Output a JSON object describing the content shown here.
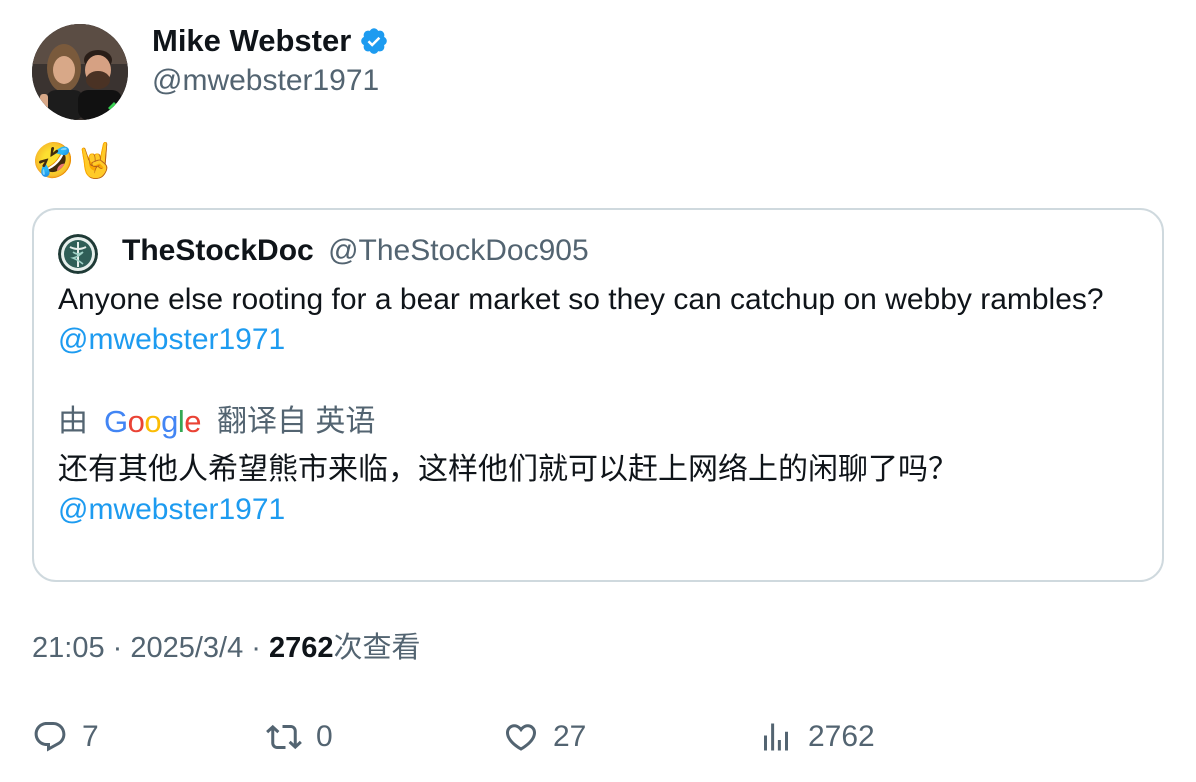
{
  "author": {
    "name": "Mike Webster",
    "handle": "@mwebster1971",
    "verified": true
  },
  "tweet": {
    "text": "🤣🤘"
  },
  "quote": {
    "name": "TheStockDoc",
    "handle": "@TheStockDoc905",
    "text_before_mention": "Anyone else rooting for a bear market so they can catchup on webby rambles? ",
    "mention": "@mwebster1971",
    "translate": {
      "prefix": "由",
      "provider": "Google",
      "suffix": "翻译自 英语"
    },
    "translated_text": "还有其他人希望熊市来临，这样他们就可以赶上网络上的闲聊了吗？",
    "translated_mention": "@mwebster1971"
  },
  "meta": {
    "time": "21:05",
    "separator": " · ",
    "date": "2025/3/4",
    "views_count": "2762",
    "views_label": "次查看"
  },
  "actions": {
    "replies": "7",
    "reposts": "0",
    "likes": "27",
    "views": "2762"
  },
  "colors": {
    "accent": "#1d9bf0",
    "secondary_text": "#536471",
    "border": "#cfd9de"
  }
}
